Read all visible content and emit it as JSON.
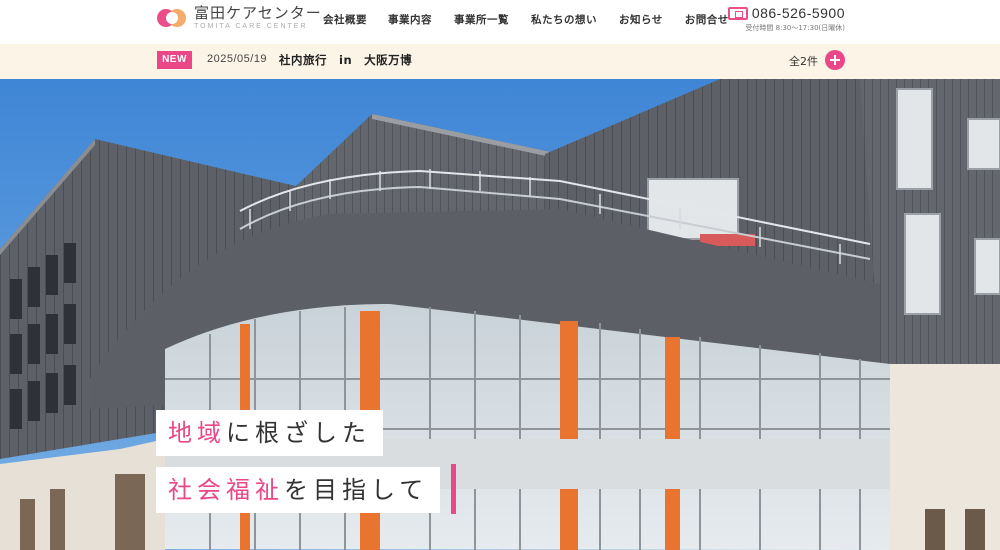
{
  "logo": {
    "name_jp": "富田ケアセンター",
    "name_en": "TOMITA CARE CENTER"
  },
  "nav": [
    {
      "label": "会社概要"
    },
    {
      "label": "事業内容"
    },
    {
      "label": "事業所一覧"
    },
    {
      "label": "私たちの想い"
    },
    {
      "label": "お知らせ"
    },
    {
      "label": "お問合せ"
    }
  ],
  "contact": {
    "phone": "086-526-5900",
    "hours": "受付時間 8:30〜17:30(日曜休)"
  },
  "news": {
    "badge": "NEW",
    "date": "2025/05/19",
    "title": "社内旅行　in　大阪万博",
    "count": "全2件"
  },
  "hero": {
    "catch_line1_accent": "地域",
    "catch_line1_rest": "に根ざした",
    "catch_line2_accent": "社会福祉",
    "catch_line2_rest": "を目指して"
  },
  "colors": {
    "accent": "#e94788",
    "newsbar_bg": "#fcf5e7",
    "sky": "#4d8fd6"
  },
  "icons": {
    "phone": "phone-icon",
    "more": "plus-circle-icon"
  }
}
